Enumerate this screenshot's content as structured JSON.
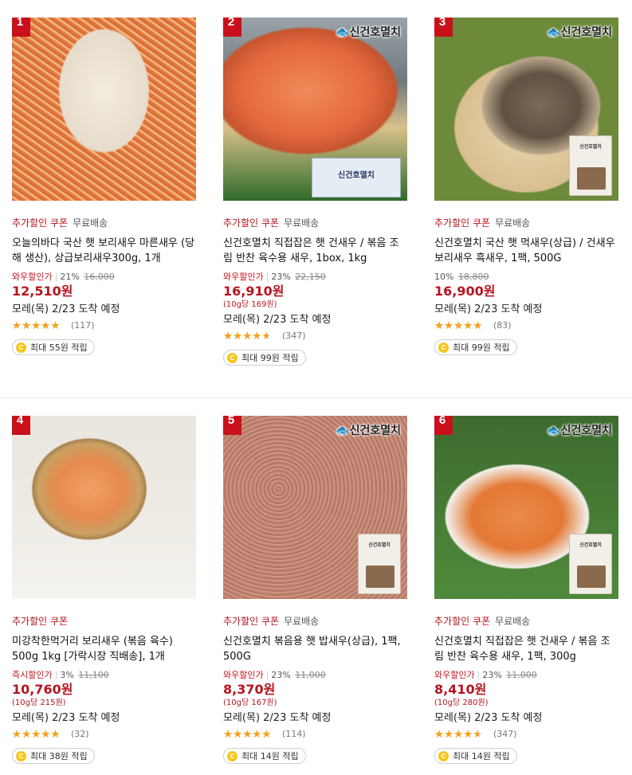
{
  "products": [
    {
      "rank": "1",
      "image": "dried-baby-shrimp-in-hands",
      "brand_logo": "",
      "package_logo": "",
      "badges": {
        "coupon": "추가할인 쿠폰",
        "shipping": "무료배송"
      },
      "title": "오늘의바다 국산 햇 보리새우 마른새우 (당해 생산), 상급보리새우300g, 1개",
      "discount_label": "와우할인가",
      "discount_rate": "21%",
      "original_price": "16,000",
      "price": "12,510원",
      "unit_price": "",
      "delivery": "모레(목) 2/23 도착 예정",
      "rating": 4.5,
      "review_count": "(117)",
      "reward": "최대 55원 적립"
    },
    {
      "rank": "2",
      "image": "dried-red-shrimp-basket",
      "brand_logo": "신건호멸치",
      "package_logo": "신건호멸치",
      "badges": {
        "coupon": "추가할인 쿠폰",
        "shipping": "무료배송"
      },
      "title": "신건호멸치 직접잡은 햇 건새우 / 볶음 조림 반찬 육수용 새우, 1box, 1kg",
      "discount_label": "와우할인가",
      "discount_rate": "23%",
      "original_price": "22,150",
      "price": "16,910원",
      "unit_price": "(10g당 169원)",
      "delivery": "모레(목) 2/23 도착 예정",
      "rating": 4.0,
      "review_count": "(347)",
      "reward": "최대 99원 적립"
    },
    {
      "rank": "3",
      "image": "dried-brown-shrimp-plate",
      "brand_logo": "신건호멸치",
      "package_logo": "신건호멸치",
      "badges": {
        "coupon": "추가할인 쿠폰",
        "shipping": "무료배송"
      },
      "title": "신건호멸치 국산 햇 먹새우(상급) / 건새우 보리새우 흑새우, 1팩, 500G",
      "discount_label": "",
      "discount_rate": "10%",
      "original_price": "18,800",
      "price": "16,900원",
      "unit_price": "",
      "delivery": "모레(목) 2/23 도착 예정",
      "rating": 4.5,
      "review_count": "(83)",
      "reward": "최대 99원 적립"
    },
    {
      "rank": "4",
      "image": "dried-shrimp-bamboo-basket",
      "brand_logo": "",
      "package_logo": "",
      "badges": {
        "coupon": "추가할인 쿠폰",
        "shipping": ""
      },
      "title": "미강착한먹거리 보리새우 (볶음 육수) 500g 1kg [가락시장 직배송], 1개",
      "discount_label": "즉시할인가",
      "discount_rate": "3%",
      "original_price": "11,100",
      "price": "10,760원",
      "unit_price": "(10g당 215원)",
      "delivery": "모레(목) 2/23 도착 예정",
      "rating": 4.5,
      "review_count": "(32)",
      "reward": "최대 38원 적립"
    },
    {
      "rank": "5",
      "image": "dried-tiny-shrimp-pile",
      "brand_logo": "신건호멸치",
      "package_logo": "신건호멸치",
      "badges": {
        "coupon": "추가할인 쿠폰",
        "shipping": "무료배송"
      },
      "title": "신건호멸치 볶음용 햇 밥새우(상급), 1팩, 500G",
      "discount_label": "와우할인가",
      "discount_rate": "23%",
      "original_price": "11,000",
      "price": "8,370원",
      "unit_price": "(10g당 167원)",
      "delivery": "모레(목) 2/23 도착 예정",
      "rating": 4.5,
      "review_count": "(114)",
      "reward": "최대 14원 적립"
    },
    {
      "rank": "6",
      "image": "large-dried-shrimp-plate",
      "brand_logo": "신건호멸치",
      "package_logo": "신건호멸치",
      "badges": {
        "coupon": "추가할인 쿠폰",
        "shipping": "무료배송"
      },
      "title": "신건호멸치 직접잡은 햇 건새우 / 볶음 조림 반찬 육수용 새우, 1팩, 300g",
      "discount_label": "와우할인가",
      "discount_rate": "23%",
      "original_price": "11,000",
      "price": "8,410원",
      "unit_price": "(10g당 280원)",
      "delivery": "모레(목) 2/23 도착 예정",
      "rating": 4.0,
      "review_count": "(347)",
      "reward": "최대 14원 적립"
    }
  ],
  "icons": {
    "coin": "C",
    "star_glyphs": "★★★★★"
  },
  "colors": {
    "accent_red": "#c9101b",
    "price_red": "#b6151f",
    "star": "#f4a31d",
    "coin": "#f7c51d"
  }
}
